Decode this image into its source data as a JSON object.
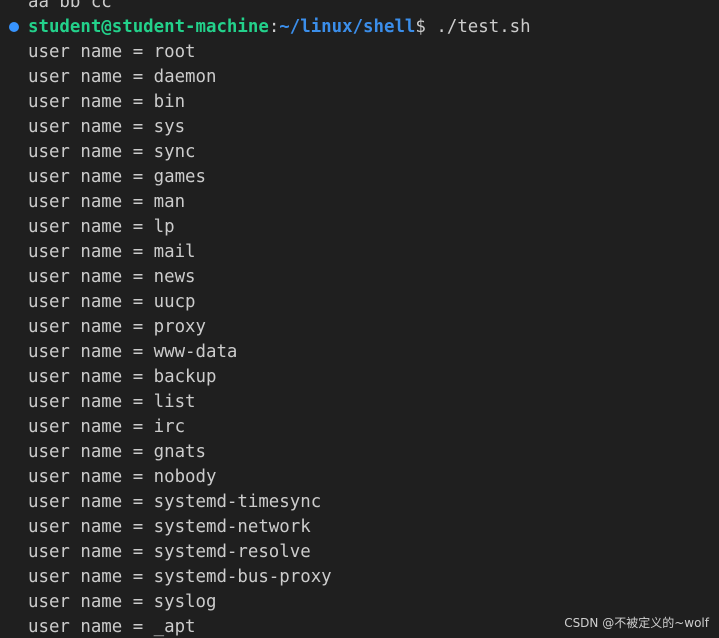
{
  "terminal": {
    "previous_line": "aa bb cc",
    "prompt": {
      "user_host": "student@student-machine",
      "separator": ":",
      "path": "~/linux/shell",
      "dollar": "$",
      "command": " ./test.sh"
    },
    "output_lines": [
      "user name = root",
      "user name = daemon",
      "user name = bin",
      "user name = sys",
      "user name = sync",
      "user name = games",
      "user name = man",
      "user name = lp",
      "user name = mail",
      "user name = news",
      "user name = uucp",
      "user name = proxy",
      "user name = www-data",
      "user name = backup",
      "user name = list",
      "user name = irc",
      "user name = gnats",
      "user name = nobody",
      "user name = systemd-timesync",
      "user name = systemd-network",
      "user name = systemd-resolve",
      "user name = systemd-bus-proxy",
      "user name = syslog",
      "user name = _apt"
    ]
  },
  "watermark": "CSDN @不被定义的~wolf",
  "colors": {
    "background": "#1f1f1f",
    "text": "#cccccc",
    "prompt_user": "#23d18b",
    "prompt_path": "#3b8eea",
    "command_marker": "#3794ff"
  }
}
